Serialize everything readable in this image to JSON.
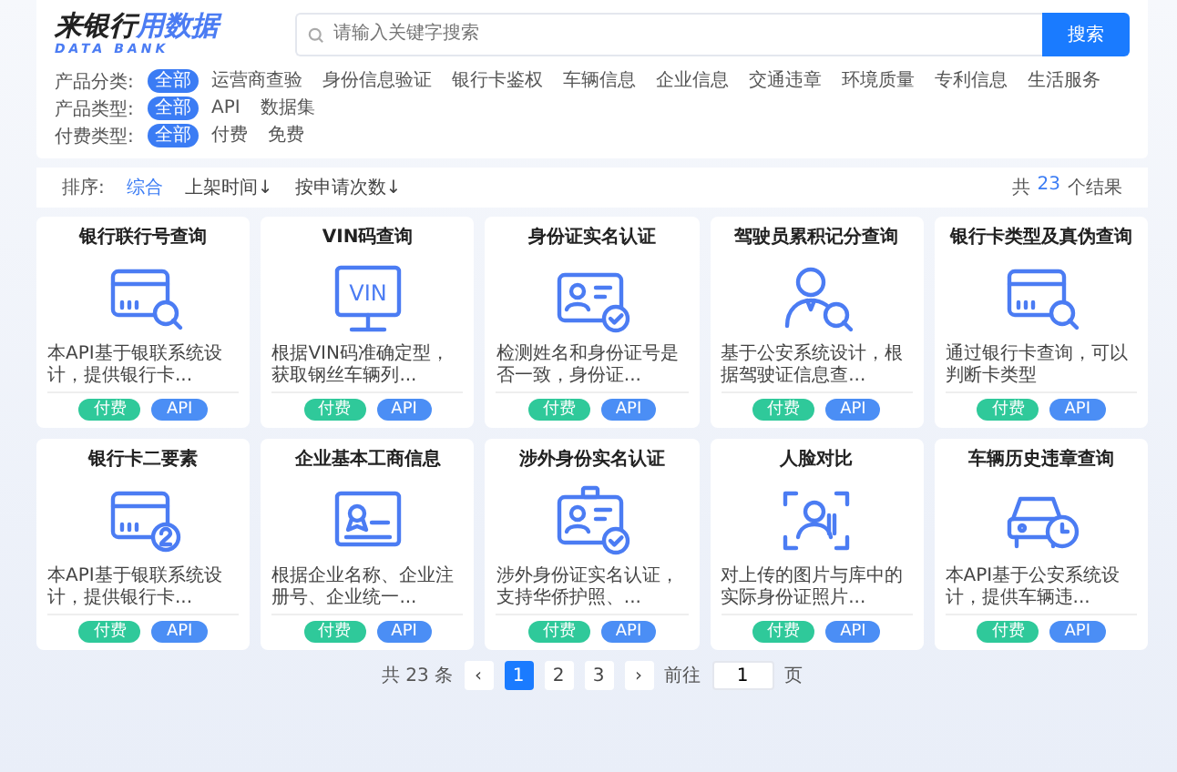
{
  "logo": {
    "title": "来银行",
    "title_highlight": "用数据",
    "subtitle": "DATA BANK"
  },
  "search": {
    "placeholder": "请输入关键字搜索",
    "button": "搜索"
  },
  "filters": [
    {
      "label": "产品分类:",
      "options": [
        {
          "label": "全部",
          "selected": true
        },
        {
          "label": "运营商查验",
          "selected": false
        },
        {
          "label": "身份信息验证",
          "selected": false
        },
        {
          "label": "银行卡鉴权",
          "selected": false
        },
        {
          "label": "车辆信息",
          "selected": false
        },
        {
          "label": "企业信息",
          "selected": false
        },
        {
          "label": "交通违章",
          "selected": false
        },
        {
          "label": "环境质量",
          "selected": false
        },
        {
          "label": "专利信息",
          "selected": false
        },
        {
          "label": "生活服务",
          "selected": false
        }
      ]
    },
    {
      "label": "产品类型:",
      "options": [
        {
          "label": "全部",
          "selected": true
        },
        {
          "label": "API",
          "selected": false
        },
        {
          "label": "数据集",
          "selected": false
        }
      ]
    },
    {
      "label": "付费类型:",
      "options": [
        {
          "label": "全部",
          "selected": true
        },
        {
          "label": "付费",
          "selected": false
        },
        {
          "label": "免费",
          "selected": false
        }
      ]
    }
  ],
  "sort": {
    "label": "排序:",
    "options": [
      {
        "label": "综合",
        "selected": true
      },
      {
        "label": "上架时间↓",
        "selected": false
      },
      {
        "label": "按申请次数↓",
        "selected": false
      }
    ],
    "result_prefix": "共",
    "result_count": "23",
    "result_suffix": "个结果"
  },
  "cards": [
    {
      "title": "银行联行号查询",
      "kind": "card-search",
      "description": "本API基于银联系统设计，提供银行卡...",
      "tags": [
        {
          "label": "付费",
          "color": "#2fc99a"
        },
        {
          "label": "API",
          "color": "#4b8ef5"
        }
      ]
    },
    {
      "title": "VIN码查询",
      "kind": "monitor",
      "screen_text": "VIN",
      "description": "根据VIN码准确定型，获取钢丝车辆列...",
      "tags": [
        {
          "label": "付费",
          "color": "#2fc99a"
        },
        {
          "label": "API",
          "color": "#4b8ef5"
        }
      ]
    },
    {
      "title": "身份证实名认证",
      "kind": "id-check",
      "description": "检测姓名和身份证号是否一致，身份证...",
      "tags": [
        {
          "label": "付费",
          "color": "#2fc99a"
        },
        {
          "label": "API",
          "color": "#4b8ef5"
        }
      ]
    },
    {
      "title": "驾驶员累积记分查询",
      "kind": "person",
      "description": "基于公安系统设计，根据驾驶证信息查...",
      "tags": [
        {
          "label": "付费",
          "color": "#2fc99a"
        },
        {
          "label": "API",
          "color": "#4b8ef5"
        }
      ]
    },
    {
      "title": "银行卡类型及真伪查询",
      "kind": "card-search",
      "description": "通过银行卡查询，可以判断卡类型",
      "tags": [
        {
          "label": "付费",
          "color": "#2fc99a"
        },
        {
          "label": "API",
          "color": "#4b8ef5"
        }
      ]
    },
    {
      "title": "银行卡二要素",
      "kind": "card-two",
      "description": "本API基于银联系统设计，提供银行卡...",
      "tags": [
        {
          "label": "付费",
          "color": "#2fc99a"
        },
        {
          "label": "API",
          "color": "#4b8ef5"
        }
      ]
    },
    {
      "title": "企业基本工商信息",
      "kind": "certificate",
      "description": "根据企业名称、企业注册号、企业统一...",
      "tags": [
        {
          "label": "付费",
          "color": "#2fc99a"
        },
        {
          "label": "API",
          "color": "#4b8ef5"
        }
      ]
    },
    {
      "title": "涉外身份实名认证",
      "kind": "badge-check",
      "description": "涉外身份证实名认证，支持华侨护照、...",
      "tags": [
        {
          "label": "付费",
          "color": "#2fc99a"
        },
        {
          "label": "API",
          "color": "#4b8ef5"
        }
      ]
    },
    {
      "title": "人脸对比",
      "kind": "face-scan",
      "description": "对上传的图片与库中的实际身份证照片...",
      "tags": [
        {
          "label": "付费",
          "color": "#2fc99a"
        },
        {
          "label": "API",
          "color": "#4b8ef5"
        }
      ]
    },
    {
      "title": "车辆历史违章查询",
      "kind": "car-clock",
      "description": "本API基于公安系统设计，提供车辆违...",
      "tags": [
        {
          "label": "付费",
          "color": "#2fc99a"
        },
        {
          "label": "API",
          "color": "#4b8ef5"
        }
      ]
    }
  ],
  "pagination": {
    "total": "共 23 条",
    "prev": "‹",
    "pages": [
      {
        "label": "1",
        "selected": true
      },
      {
        "label": "2",
        "selected": false
      },
      {
        "label": "3",
        "selected": false
      }
    ],
    "next": "›",
    "goto_label": "前往",
    "goto_value": "1",
    "goto_suffix": "页"
  }
}
